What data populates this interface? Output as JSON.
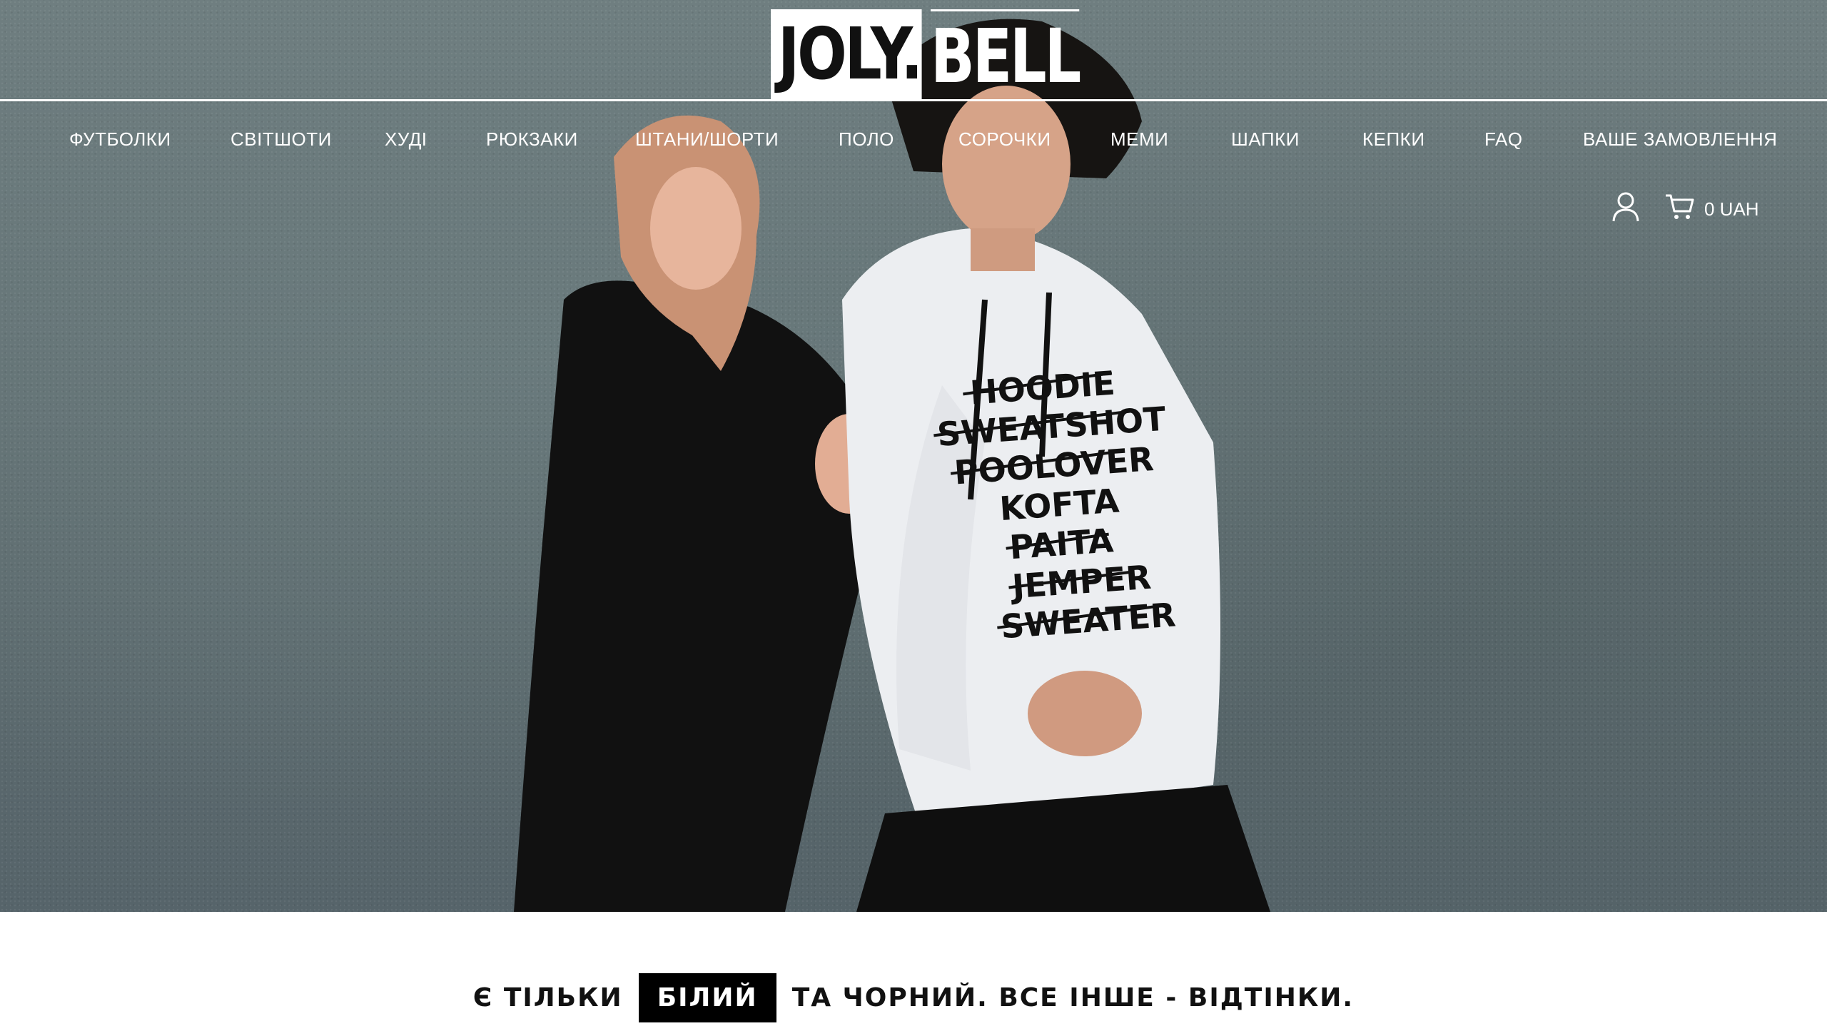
{
  "header": {
    "logo_left": "JOLY.",
    "logo_right": "BELL"
  },
  "nav": {
    "items": [
      {
        "label": "ФУТБОЛКИ"
      },
      {
        "label": "СВІТШОТИ"
      },
      {
        "label": "ХУДІ"
      },
      {
        "label": "РЮКЗАКИ"
      },
      {
        "label": "ШТАНИ/ШОРТИ"
      },
      {
        "label": "ПОЛО"
      },
      {
        "label": "СОРОЧКИ"
      },
      {
        "label": "МЕМИ"
      },
      {
        "label": "ШАПКИ"
      },
      {
        "label": "КЕПКИ"
      },
      {
        "label": "FAQ"
      },
      {
        "label": "ВАШЕ ЗАМОВЛЕННЯ"
      }
    ]
  },
  "account": {
    "user_icon": "user-icon",
    "cart_icon": "cart-icon",
    "cart_total": "0 UAH"
  },
  "hero": {
    "hoodie_lines": [
      "HOODIE",
      "SWEATSHOT",
      "POOLOVER",
      "KOFTA",
      "PAITA",
      "JEMPER",
      "SWEATER"
    ],
    "background_color": "#627173"
  },
  "tagline": {
    "part1": "Є ТІЛЬКИ",
    "highlight": "БІЛИЙ",
    "part2": "ТА ЧОРНИЙ. ВСЕ ІНШЕ - ВІДТІНКИ."
  }
}
